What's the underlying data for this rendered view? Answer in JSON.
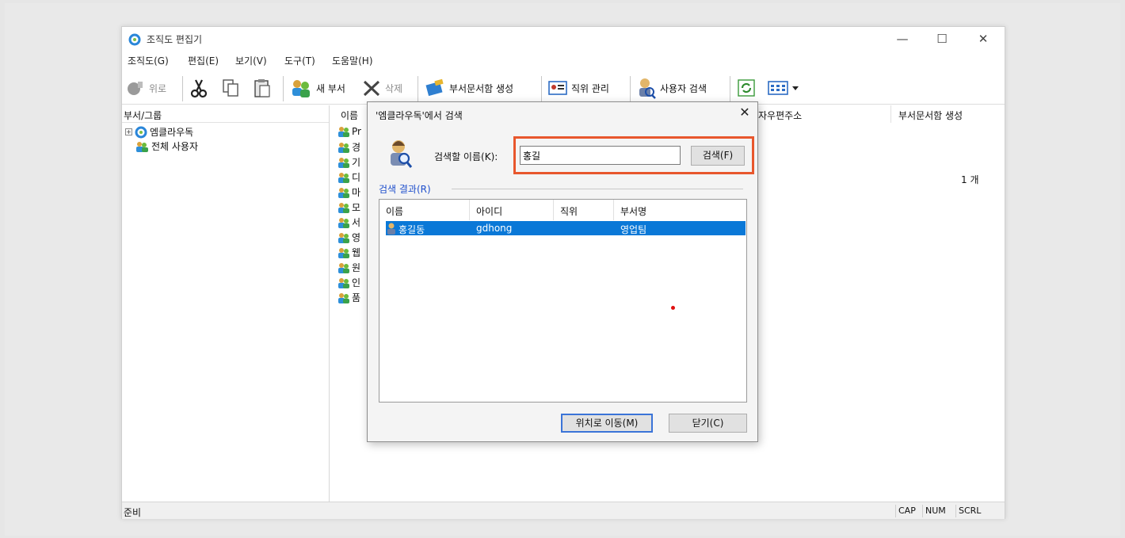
{
  "window": {
    "title": "조직도 편집기",
    "controls": {
      "minimize": "—",
      "maximize": "☐",
      "close": "✕"
    }
  },
  "menu": [
    "조직도(G)",
    "편집(E)",
    "보기(V)",
    "도구(T)",
    "도움말(H)"
  ],
  "toolbar": {
    "up": "위로",
    "new_dept": "새 부서",
    "delete": "삭제",
    "dept_doc": "부서문서함 생성",
    "position_mgmt": "직위 관리",
    "user_search": "사용자 검색"
  },
  "left_pane": {
    "header": "부서/그룹",
    "tree": [
      "엠클라우독",
      "전체 사용자"
    ]
  },
  "right_pane": {
    "columns": [
      "이름",
      "자우편주소",
      "부서문서함 생성"
    ],
    "rows": [
      "Pr",
      "경",
      "기",
      "디",
      "마",
      "모",
      "서",
      "영",
      "웹",
      "원",
      "인",
      "품"
    ],
    "count": "1 개"
  },
  "statusbar": {
    "text": "준비",
    "indicators": [
      "CAP",
      "NUM",
      "SCRL"
    ]
  },
  "dialog": {
    "title": "'엠클라우독'에서 검색",
    "close": "✕",
    "search_label": "검색할 이름(K):",
    "search_value": "홍길",
    "search_button": "검색(F)",
    "results_label": "검색 결과(R)",
    "columns": [
      "이름",
      "아이디",
      "직위",
      "부서명"
    ],
    "results": [
      {
        "name": "홍길동",
        "id": "gdhong",
        "position": "",
        "department": "영업팀"
      }
    ],
    "move_button": "위치로 이동(M)",
    "close_button": "닫기(C)"
  },
  "colors": {
    "highlight": "#e8572d",
    "selection": "#0a78d7",
    "group_label": "#1f4fcc"
  }
}
